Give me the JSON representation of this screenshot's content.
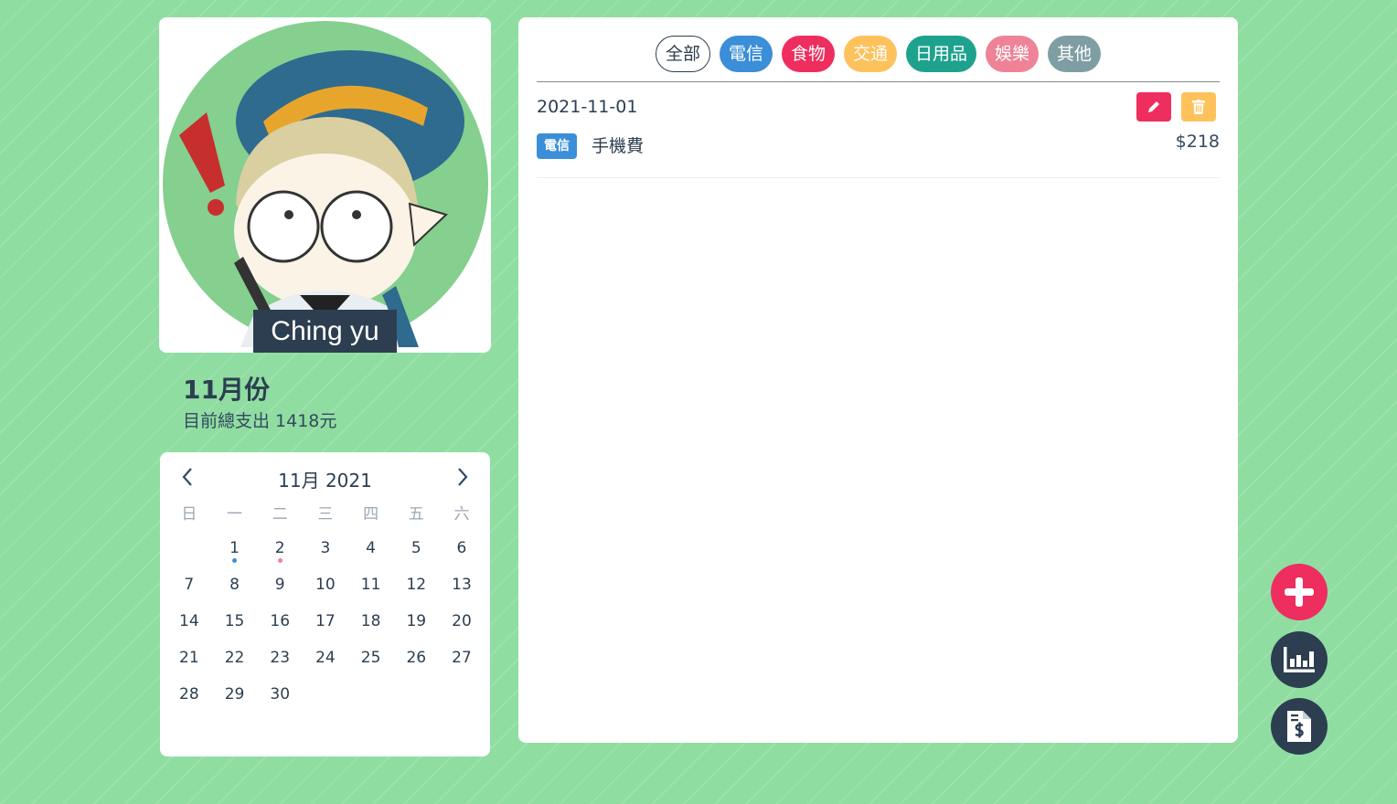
{
  "profile": {
    "name": "Ching yu"
  },
  "summary": {
    "month_title": "11月份",
    "total_text": "目前總支出 1418元"
  },
  "calendar": {
    "title": "11月 2021",
    "prev_icon": "chevron-left-icon",
    "next_icon": "chevron-right-icon",
    "weekdays": [
      "日",
      "一",
      "二",
      "三",
      "四",
      "五",
      "六"
    ],
    "weeks": [
      [
        "",
        "1",
        "2",
        "3",
        "4",
        "5",
        "6"
      ],
      [
        "7",
        "8",
        "9",
        "10",
        "11",
        "12",
        "13"
      ],
      [
        "14",
        "15",
        "16",
        "17",
        "18",
        "19",
        "20"
      ],
      [
        "21",
        "22",
        "23",
        "24",
        "25",
        "26",
        "27"
      ],
      [
        "28",
        "29",
        "30",
        "",
        "",
        "",
        ""
      ]
    ],
    "markers": [
      {
        "day": "1",
        "color": "#3b8ed8"
      },
      {
        "day": "2",
        "color": "#ee8398"
      }
    ]
  },
  "filters": [
    {
      "label": "全部",
      "style": "outline",
      "color": "#ffffff"
    },
    {
      "label": "電信",
      "style": "fill",
      "color": "#3b8ed8"
    },
    {
      "label": "食物",
      "style": "fill",
      "color": "#ee2e5f"
    },
    {
      "label": "交通",
      "style": "fill",
      "color": "#fec25c"
    },
    {
      "label": "日用品",
      "style": "fill",
      "color": "#1ea28e"
    },
    {
      "label": "娛樂",
      "style": "fill",
      "color": "#ee8398"
    },
    {
      "label": "其他",
      "style": "fill",
      "color": "#7f9ea3"
    }
  ],
  "entries": [
    {
      "date": "2021-11-01",
      "tag": "電信",
      "item": "手機費",
      "amount": "$218",
      "edit_icon": "pencil-icon",
      "delete_icon": "trash-icon"
    }
  ],
  "actions": {
    "add_icon": "plus-icon",
    "chart_icon": "bar-chart-icon",
    "bill_icon": "invoice-dollar-icon"
  },
  "colors": {
    "background": "#8fdda1",
    "navy": "#2c3e50",
    "accent_red": "#ee2e5f",
    "accent_yellow": "#fec25c"
  }
}
